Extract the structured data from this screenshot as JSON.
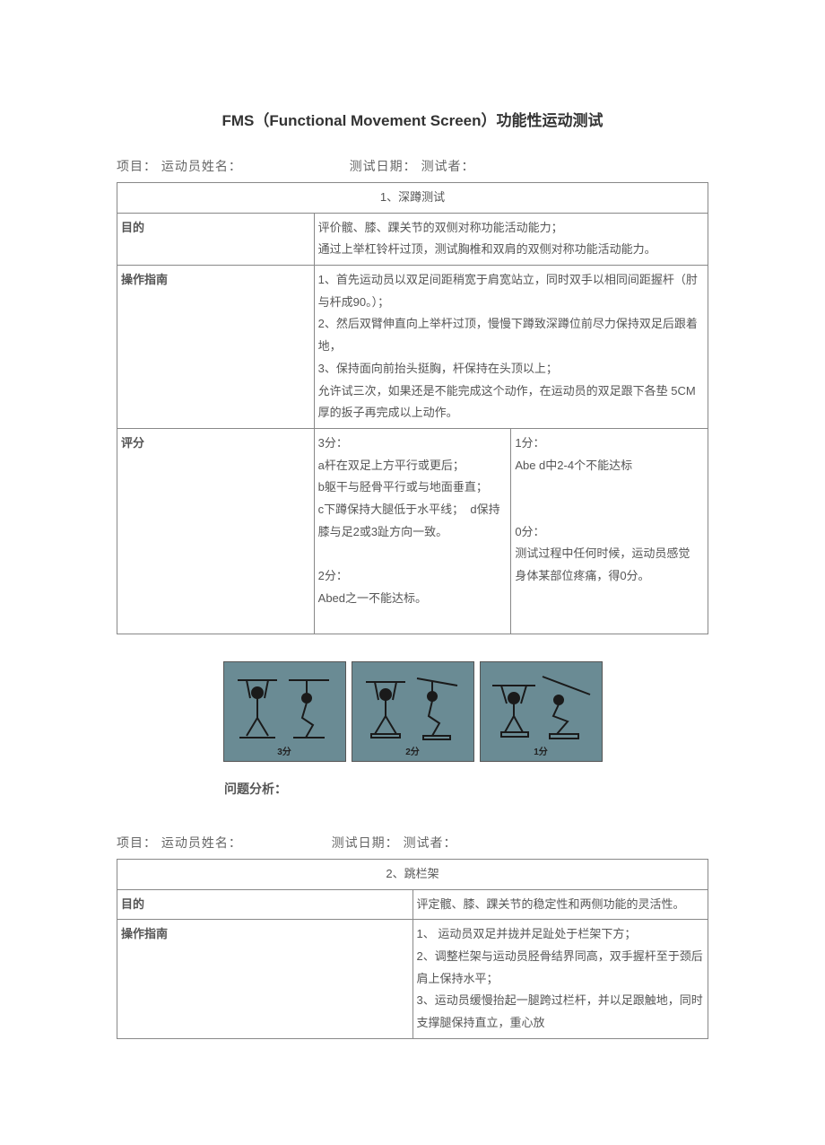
{
  "title": "FMS（Functional Movement Screen）功能性运动测试",
  "header": {
    "project": "项目：",
    "athlete": "运动员姓名：",
    "date": "测试日期：",
    "tester": "测试者："
  },
  "test1": {
    "section_title": "1、深蹲测试",
    "purpose_label": "目的",
    "purpose_text": "评价髋、膝、踝关节的双侧对称功能活动能力；\n通过上举杠铃杆过顶，测试胸椎和双肩的双侧对称功能活动能力。",
    "instructions_label": "操作指南",
    "instructions_text": "1、首先运动员以双足间距稍宽于肩宽站立，同时双手以相同间距握杆（肘与杆成90。）；\n2、然后双臂伸直向上举杆过顶，慢慢下蹲致深蹲位前尽力保持双足后跟着地，\n3、保持面向前抬头挺胸，杆保持在头顶以上；\n允许试三次，如果还是不能完成这个动作，在运动员的双足跟下各垫 5CM厚的扳子再完成以上动作。",
    "score_label": "评分",
    "score_left": "3分：\na杆在双足上方平行或更后；\nb躯干与胫骨平行或与地面垂直；\nc下蹲保持大腿低于水平线；  d保持膝与足2或3趾方向一致。\n\n2分：\nAbed之一不能达标。",
    "score_right": "1分：\nAbe d中2-4个不能达标\n\n\n0分：\n测试过程中任何时候，运动员感觉 身体某部位疼痛，得0分。"
  },
  "images": {
    "cap1": "3分",
    "cap2": "2分",
    "cap3": "1分"
  },
  "analysis_label": "问题分析：",
  "test2": {
    "section_title": "2、跳栏架",
    "purpose_label": "目的",
    "purpose_text": "评定髋、膝、踝关节的稳定性和两侧功能的灵活性。",
    "instructions_label": "操作指南",
    "instructions_text": "1、 运动员双足并拢并足趾处于栏架下方；\n2、调整栏架与运动员胫骨结界同高，双手握杆至于颈后肩上保持水平；\n3、运动员缓慢抬起一腿跨过栏杆，并以足跟触地，同时支撑腿保持直立，重心放"
  }
}
